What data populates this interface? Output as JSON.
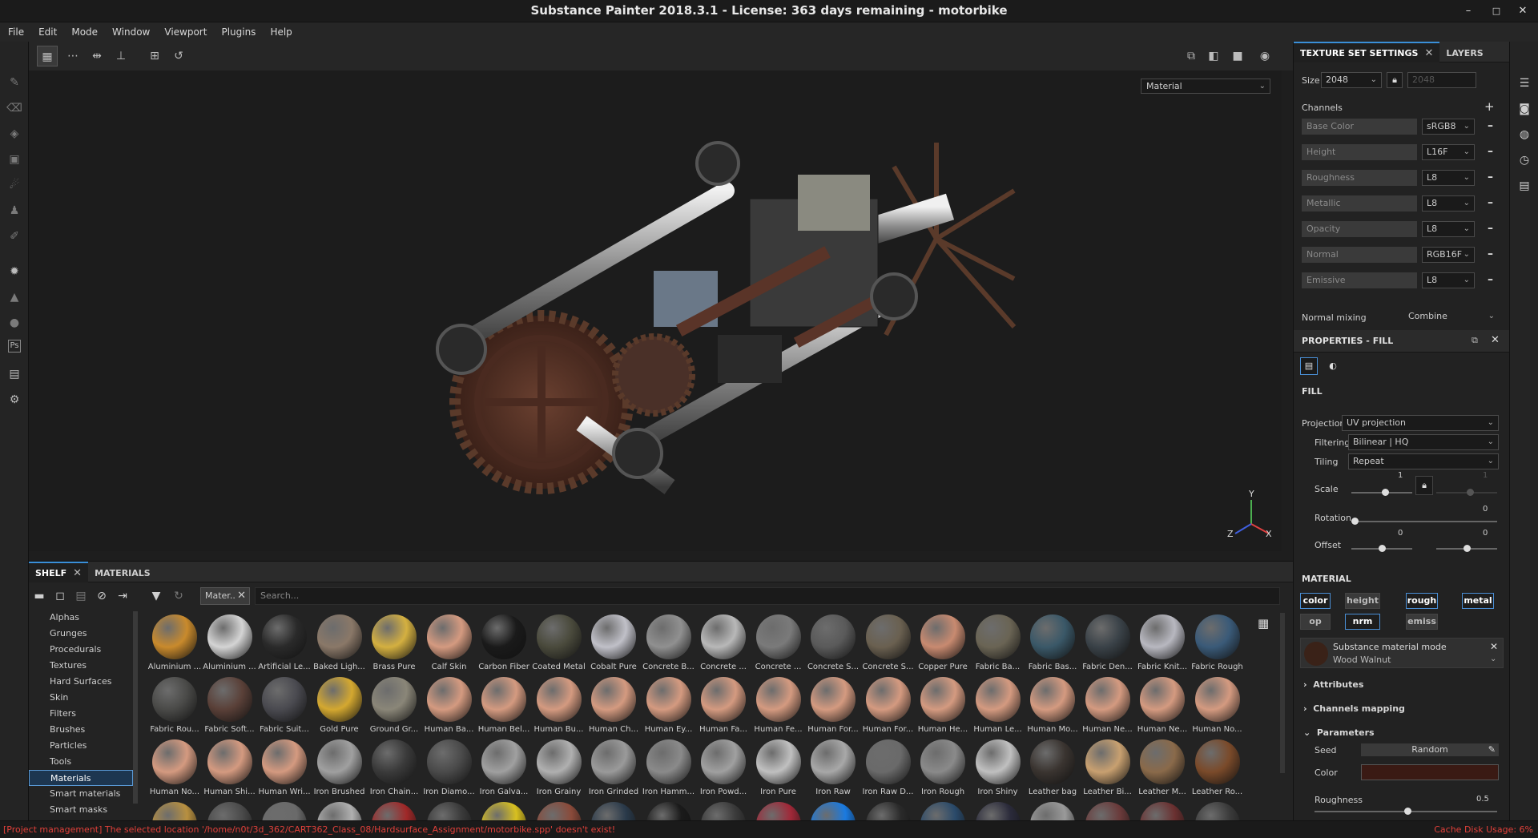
{
  "window": {
    "title": "Substance Painter 2018.3.1 - License: 363 days remaining - motorbike"
  },
  "menu": [
    "File",
    "Edit",
    "Mode",
    "Window",
    "Viewport",
    "Plugins",
    "Help"
  ],
  "viewport": {
    "material_select": "Material",
    "axis_x": "X",
    "axis_y": "Y",
    "axis_z": "Z"
  },
  "shelf": {
    "tab_shelf": "SHELF",
    "tab_materials": "MATERIALS",
    "filter_tag": "Mater..",
    "search_placeholder": "Search...",
    "categories": [
      "Alphas",
      "Grunges",
      "Procedurals",
      "Textures",
      "Hard Surfaces",
      "Skin",
      "Filters",
      "Brushes",
      "Particles",
      "Tools",
      "Materials",
      "Smart materials",
      "Smart masks"
    ],
    "selected_category": "Materials",
    "items": [
      [
        "Aluminium ...",
        "Aluminium ...",
        "Artificial Le...",
        "Baked Ligh...",
        "Brass Pure",
        "Calf Skin",
        "Carbon Fiber",
        "Coated Metal",
        "Cobalt Pure",
        "Concrete B...",
        "Concrete ...",
        "Concrete ...",
        "Concrete S...",
        "Concrete S...",
        "Copper Pure",
        "Fabric Ba...",
        "Fabric Bas...",
        "Fabric Den...",
        "Fabric Knit...",
        "Fabric Rough"
      ],
      [
        "Fabric Rou...",
        "Fabric Soft...",
        "Fabric Suit...",
        "Gold Pure",
        "Ground Gr...",
        "Human Ba...",
        "Human Bel...",
        "Human Bu...",
        "Human Ch...",
        "Human Ey...",
        "Human Fa...",
        "Human Fe...",
        "Human For...",
        "Human For...",
        "Human He...",
        "Human Le...",
        "Human Mo...",
        "Human Ne...",
        "Human Ne...",
        "Human No..."
      ],
      [
        "Human No...",
        "Human Shi...",
        "Human Wri...",
        "Iron Brushed",
        "Iron Chain...",
        "Iron Diamo...",
        "Iron Galva...",
        "Iron Grainy",
        "Iron Grinded",
        "Iron Hamm...",
        "Iron Powd...",
        "Iron Pure",
        "Iron Raw",
        "Iron Raw D...",
        "Iron Rough",
        "Iron Shiny",
        "Leather bag",
        "Leather Bi...",
        "Leather M...",
        "Leather Ro..."
      ]
    ],
    "row_colors": [
      [
        "#c98a2c",
        "#d4d4d4",
        "#2a2a2a",
        "#8a7868",
        "#d4b040",
        "#d49a80",
        "#1a1a1a",
        "#4a4a3c",
        "#c0c0c8",
        "#909090",
        "#b8b8b8",
        "#7a7a7a",
        "#5a5a5a",
        "#6a6050",
        "#c88a70",
        "#6a6454",
        "#3a5868",
        "#3a4248",
        "#b8b8c0",
        "#3a5a78"
      ],
      [
        "#4a4a48",
        "#5a4038",
        "#4a4a50",
        "#d4a830",
        "#8a8678",
        "#d49a80",
        "#d49a80",
        "#d49a80",
        "#d49a80",
        "#d49a80",
        "#d49a80",
        "#d49a80",
        "#d49a80",
        "#d49a80",
        "#d49a80",
        "#d49a80",
        "#d49a80",
        "#d49a80",
        "#d49a80",
        "#d49a80"
      ],
      [
        "#d49a80",
        "#d49a80",
        "#d49a80",
        "#a0a0a0",
        "#3a3a3a",
        "#4a4a4a",
        "#a0a0a0",
        "#b0b0b0",
        "#9a9a9a",
        "#8a8a8a",
        "#a0a0a0",
        "#c0c0c0",
        "#a8a8a8",
        "#6a6a6a",
        "#8a8a8a",
        "#c0c0c0",
        "#3a3430",
        "#c8a070",
        "#8a6a4a",
        "#7a4a2a"
      ]
    ],
    "partial_row_colors": [
      "#b89040",
      "#4a4a4a",
      "#6a6a6a",
      "#b0b0b0",
      "#a02828",
      "#3a3a3a",
      "#d8c020",
      "#8a4a3a",
      "#2a3a4a",
      "#1a1a1a",
      "#3a3a3a",
      "#a02838",
      "#1a7ae0",
      "#2a2a2a",
      "#2a4a6a",
      "#2a2a3a",
      "#9a9a9a",
      "#6a3a3a",
      "#6a3030",
      "#3a3a3a"
    ]
  },
  "texture_set": {
    "tab_tss": "TEXTURE SET SETTINGS",
    "tab_layers": "LAYERS",
    "size_label": "Size",
    "size_value": "2048",
    "size_value2": "2048",
    "channels_label": "Channels",
    "channels": [
      {
        "name": "Base Color",
        "format": "sRGB8"
      },
      {
        "name": "Height",
        "format": "L16F"
      },
      {
        "name": "Roughness",
        "format": "L8"
      },
      {
        "name": "Metallic",
        "format": "L8"
      },
      {
        "name": "Opacity",
        "format": "L8"
      },
      {
        "name": "Normal",
        "format": "RGB16F"
      },
      {
        "name": "Emissive",
        "format": "L8"
      }
    ],
    "normal_mixing_label": "Normal mixing",
    "normal_mixing_value": "Combine"
  },
  "properties": {
    "header": "PROPERTIES - FILL",
    "fill_label": "FILL",
    "projection_label": "Projection",
    "projection_value": "UV projection",
    "filtering_label": "Filtering",
    "filtering_value": "Bilinear | HQ",
    "tiling_label": "Tiling",
    "tiling_value": "Repeat",
    "scale_label": "Scale",
    "scale_value": "1",
    "scale_value2": "1",
    "rotation_label": "Rotation",
    "rotation_value": "0",
    "offset_label": "Offset",
    "offset_value1": "0",
    "offset_value2": "0",
    "material_label": "MATERIAL",
    "chips_row1": [
      "color",
      "height",
      "rough",
      "metal"
    ],
    "chips_row2": [
      "op",
      "nrm",
      "emiss"
    ],
    "substance_mode_label": "Substance material mode",
    "substance_name": "Wood Walnut",
    "attributes_label": "Attributes",
    "channels_mapping_label": "Channels mapping",
    "parameters_label": "Parameters",
    "seed_label": "Seed",
    "seed_value": "Random",
    "color_label": "Color",
    "color_swatch": "#3a1a14",
    "roughness_label": "Roughness",
    "roughness_value": "0.5"
  },
  "status": {
    "message": "[Project management] The selected location '/home/n0t/3d_362/CART362_Class_08/Hardsurface_Assignment/motorbike.spp' doesn't exist!",
    "cache": "Cache Disk Usage:    6%"
  }
}
